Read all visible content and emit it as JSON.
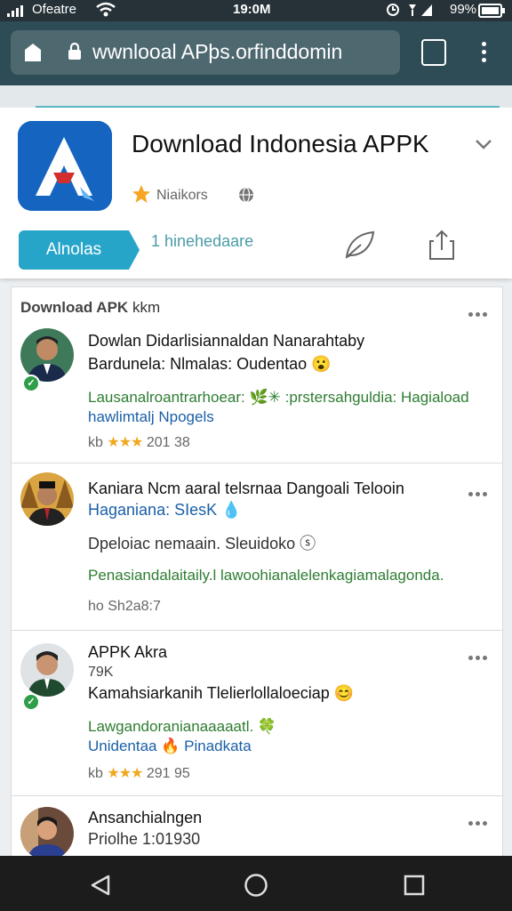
{
  "status_bar": {
    "carrier": "Ofeatre",
    "time": "19:0M",
    "battery": "99%"
  },
  "address_bar": {
    "url": "wwnlooal APþs.orfinddomin",
    "tabs_count": ""
  },
  "app": {
    "title": "Download Indonesia APPK",
    "meta": "Niaikors",
    "install_label": "Alnolas",
    "install_count": "1 hinehedaare",
    "brand_color": "#1565c0",
    "accent_color": "#26a5c9"
  },
  "feed": {
    "header_bold": "Download APK",
    "header_rest": "kkm",
    "posts": [
      {
        "lines": [
          "Dowlan Didarlisiannaldan Nanarahtaby",
          "Bardunela: Nlmalas: Oudentao 😮",
          "Lausanalroantrarhoear: 🌿✳  :prstersahguldia: Hagiaload",
          "hawlimtalj Npogels"
        ],
        "meta_prefix": "kb",
        "stars": "★★★",
        "meta_suffix": "201 38"
      },
      {
        "lines": [
          "Kaniara Ncm aaral telsrnaa Dangoali  Telooin",
          "Haganiana: SIesK 💧",
          "Dpeloiac nemaain.  Sleuidoko ⓢ",
          "Penasiandalaitaily.l  lawoohianalelenkagiamalagonda.",
          "ho  Sh2a8:7"
        ]
      },
      {
        "lines": [
          "APPK  Akra",
          "79K",
          "Kamahsiarkanih Tlelierlollaloeciap 😊",
          "Lawgandoranianaaaaatl. 🍀",
          "Unidentaa 🔥 Pinadkata"
        ],
        "meta_prefix": "kb",
        "stars": "★★★",
        "meta_suffix": "291 95"
      },
      {
        "lines": [
          "Ansanchialngen",
          "Priolhe  1:01930"
        ]
      }
    ]
  }
}
